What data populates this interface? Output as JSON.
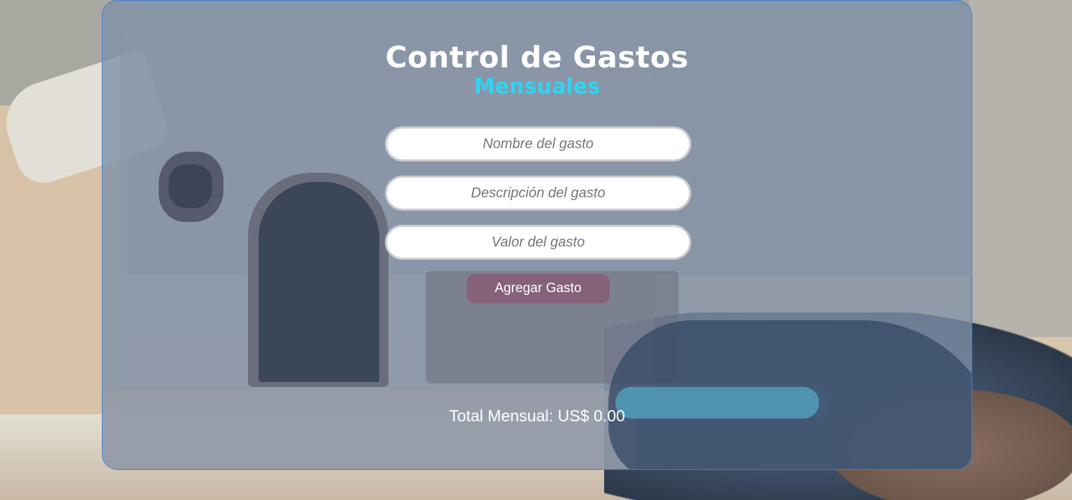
{
  "header": {
    "title": "Control de Gastos",
    "subtitle": "Mensuales"
  },
  "form": {
    "name_placeholder": "Nombre del gasto",
    "description_placeholder": "Descripción del gasto",
    "value_placeholder": "Valor del gasto",
    "name_value": "",
    "description_value": "",
    "value_value": "",
    "submit_label": "Agregar Gasto"
  },
  "summary": {
    "total_text": "Total Mensual: US$ 0.00"
  },
  "colors": {
    "panel_border": "#3d7fd6",
    "subtitle": "#2fd4f2",
    "button": "#85617a"
  }
}
